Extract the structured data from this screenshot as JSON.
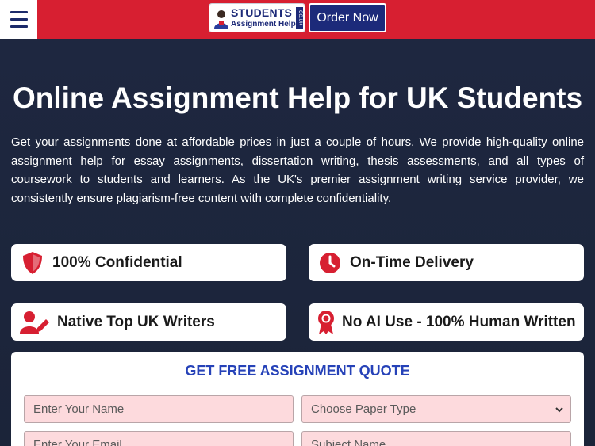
{
  "header": {
    "menu_icon": "hamburger-icon",
    "logo": {
      "main": "STUDENTS",
      "sub": "Assignment Help",
      "badge": "CO.UK"
    },
    "order_label": "Order Now",
    "colors": {
      "bar": "#d71f31",
      "order_bg": "#1c2a7a"
    }
  },
  "hero": {
    "title": "Online Assignment Help for UK Students",
    "description": "Get your assignments done at affordable prices in just a couple of hours. We provide high-quality online assignment help for essay assignments, dissertation writing, thesis assessments, and all types of coursework to students and learners. As the UK's premier assignment writing service provider, we consistently ensure plagiarism-free content with complete confidentiality."
  },
  "features": [
    {
      "label": "100% Confidential",
      "icon": "shield-icon"
    },
    {
      "label": "On-Time Delivery",
      "icon": "clock-icon"
    },
    {
      "label": "Native Top UK Writers",
      "icon": "writer-icon"
    },
    {
      "label": "No AI Use - 100% Human Written",
      "icon": "award-ribbon-icon"
    }
  ],
  "quote_form": {
    "title": "GET FREE ASSIGNMENT QUOTE",
    "name_placeholder": "Enter Your Name",
    "paper_type_selected": "Choose Paper Type",
    "email_placeholder": "Enter Your Email",
    "subject_placeholder": "Subject Name"
  }
}
